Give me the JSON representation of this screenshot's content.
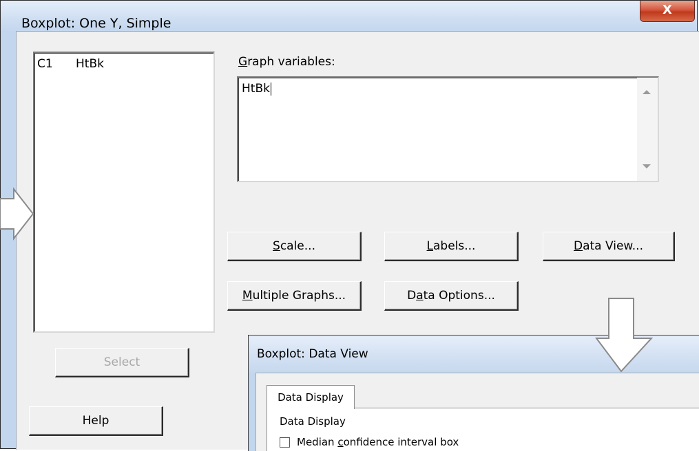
{
  "window": {
    "title": "Boxplot: One Y, Simple",
    "close_label": "X"
  },
  "variables_list": {
    "items": [
      {
        "id": "C1",
        "name": "HtBk"
      }
    ]
  },
  "graph_variables": {
    "label": "Graph variables:",
    "label_access_key": "G",
    "label_rest": "raph variables:",
    "value": "HtBk"
  },
  "buttons": {
    "scale": {
      "key": "S",
      "rest": "cale..."
    },
    "labels": {
      "key": "L",
      "rest": "abels..."
    },
    "data_view": {
      "key": "D",
      "rest": "ata View..."
    },
    "multiple_graphs": {
      "key": "M",
      "rest": "ultiple Graphs..."
    },
    "data_options": {
      "pre": "D",
      "key": "a",
      "rest": "ta Options..."
    },
    "select": "Select",
    "help": "Help"
  },
  "subdialog": {
    "title": "Boxplot: Data View",
    "tab_label": "Data Display",
    "section_label": "Data Display",
    "checkbox": {
      "pre": "Median ",
      "key": "c",
      "rest": "onfidence interval box",
      "checked": false
    }
  },
  "colors": {
    "titlebar": "#c2d6ee",
    "dialog_bg": "#f0f0f0",
    "close_red": "#c0391c",
    "arrow_fill": "#ffffff",
    "arrow_stroke": "#8a8a8a"
  }
}
